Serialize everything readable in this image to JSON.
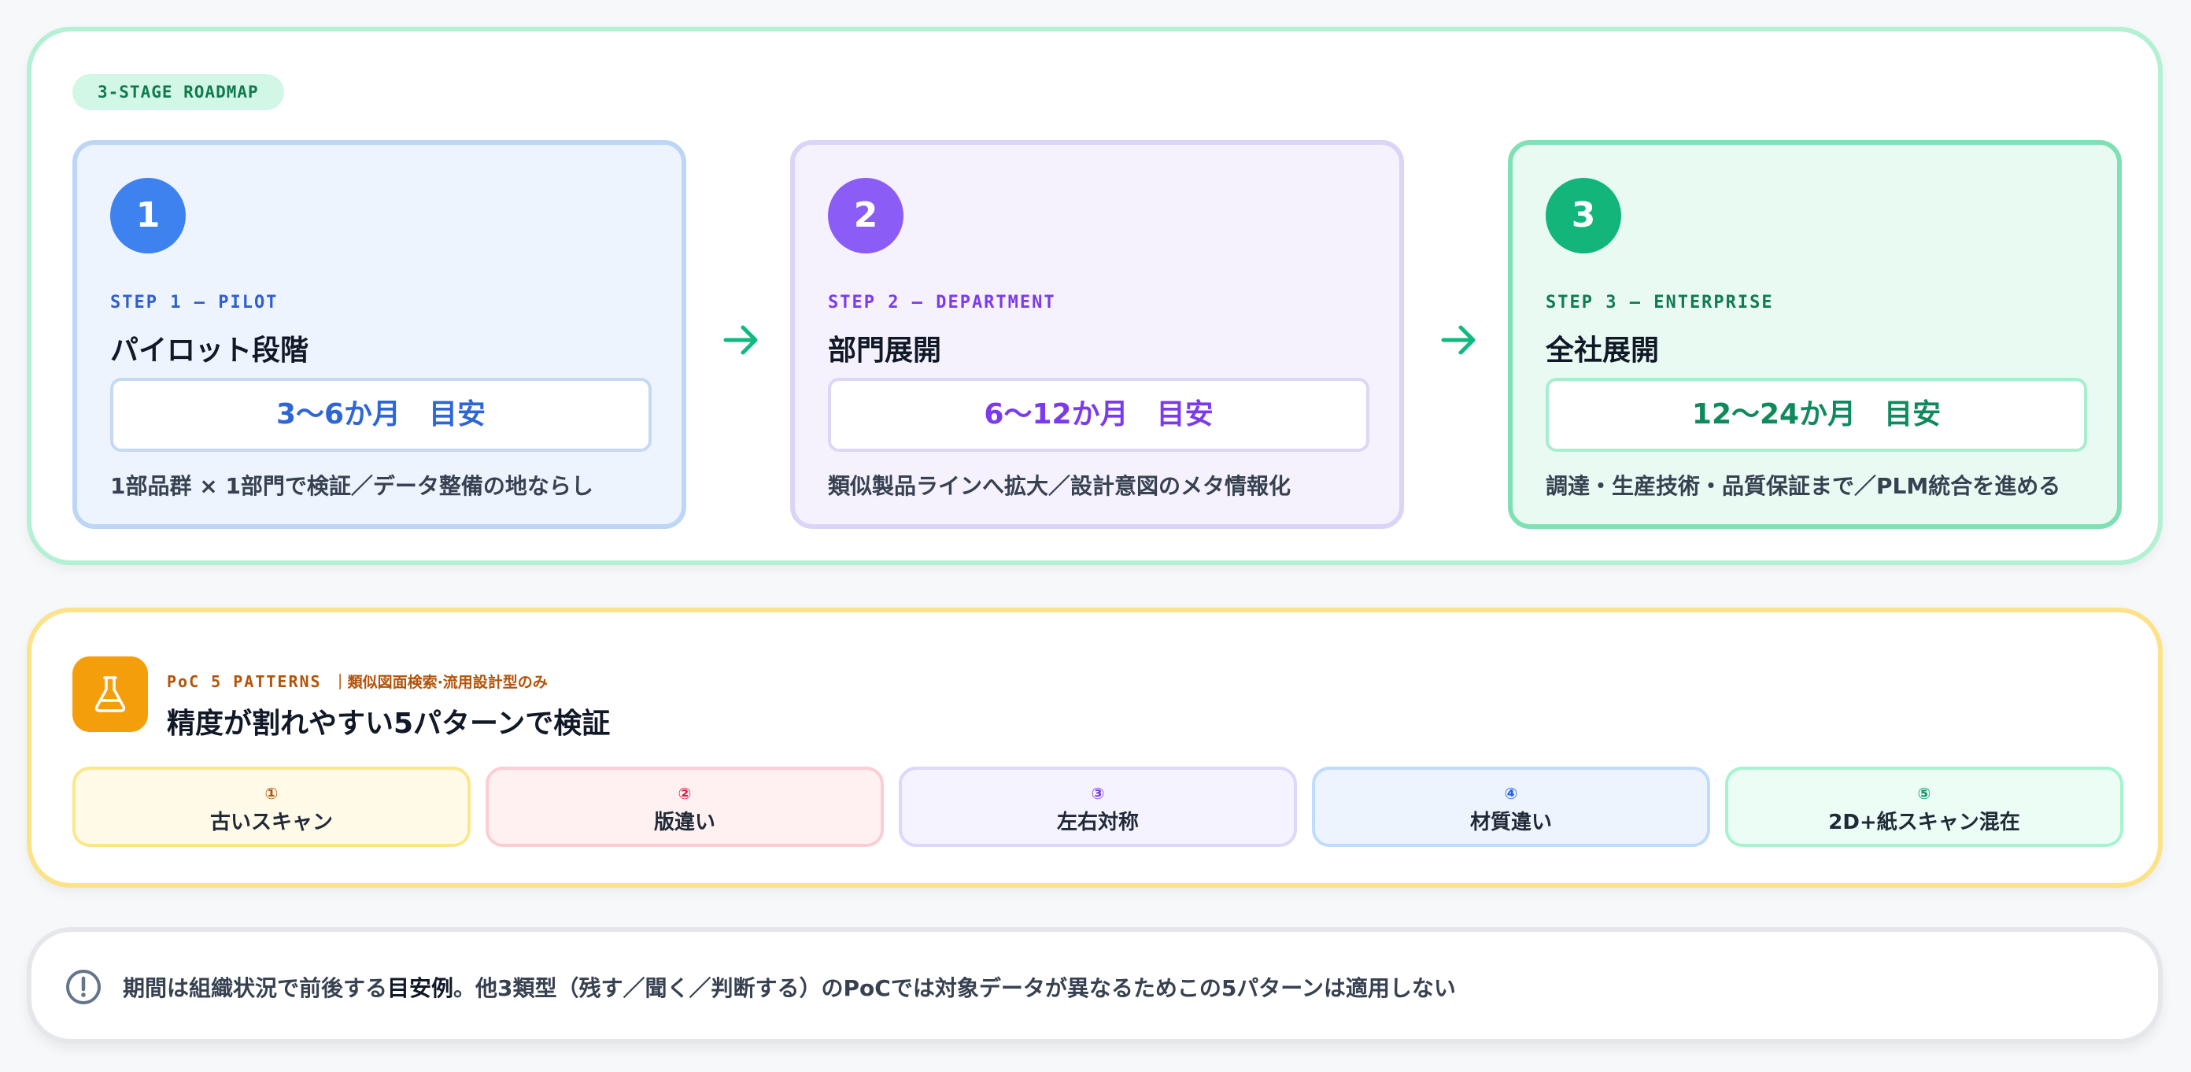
{
  "roadmap": {
    "badge": "3-STAGE ROADMAP",
    "steps": [
      {
        "number": "1",
        "eyebrow": "STEP 1 — PILOT",
        "title": "パイロット段階",
        "duration": "3〜6か月　目安",
        "desc": "1部品群 × 1部門で検証／データ整備の地ならし",
        "accent": "#3d82ee"
      },
      {
        "number": "2",
        "eyebrow": "STEP 2 — DEPARTMENT",
        "title": "部門展開",
        "duration": "6〜12か月　目安",
        "desc": "類似製品ラインへ拡大／設計意図のメタ情報化",
        "accent": "#8b5cf6"
      },
      {
        "number": "3",
        "eyebrow": "STEP 3 — ENTERPRISE",
        "title": "全社展開",
        "duration": "12〜24か月　目安",
        "desc": "調達・生産技術・品質保証まで／PLM統合を進める",
        "accent": "#12b57a"
      }
    ],
    "arrow_icon": "arrow-right-icon",
    "arrow_color": "#10b981"
  },
  "poc": {
    "icon": "flask-icon",
    "eyebrow": "PoC 5 PATTERNS",
    "eyebrow_sub": "｜類似図面検索·流用設計型のみ",
    "title": "精度が割れやすい5パターンで検証",
    "patterns": [
      {
        "num": "①",
        "label": "古いスキャン"
      },
      {
        "num": "②",
        "label": "版違い"
      },
      {
        "num": "③",
        "label": "左右対称"
      },
      {
        "num": "④",
        "label": "材質違い"
      },
      {
        "num": "⑤",
        "label": "2D+紙スキャン混在"
      }
    ]
  },
  "note": {
    "icon": "info-circle-icon",
    "text_before": "期間は組織状況で前後する",
    "text_emphasis": "目安例",
    "text_after": "。他3類型（残す／聞く／判断する）のPoCでは対象データが異なるためこの5パターンは適用しない"
  }
}
